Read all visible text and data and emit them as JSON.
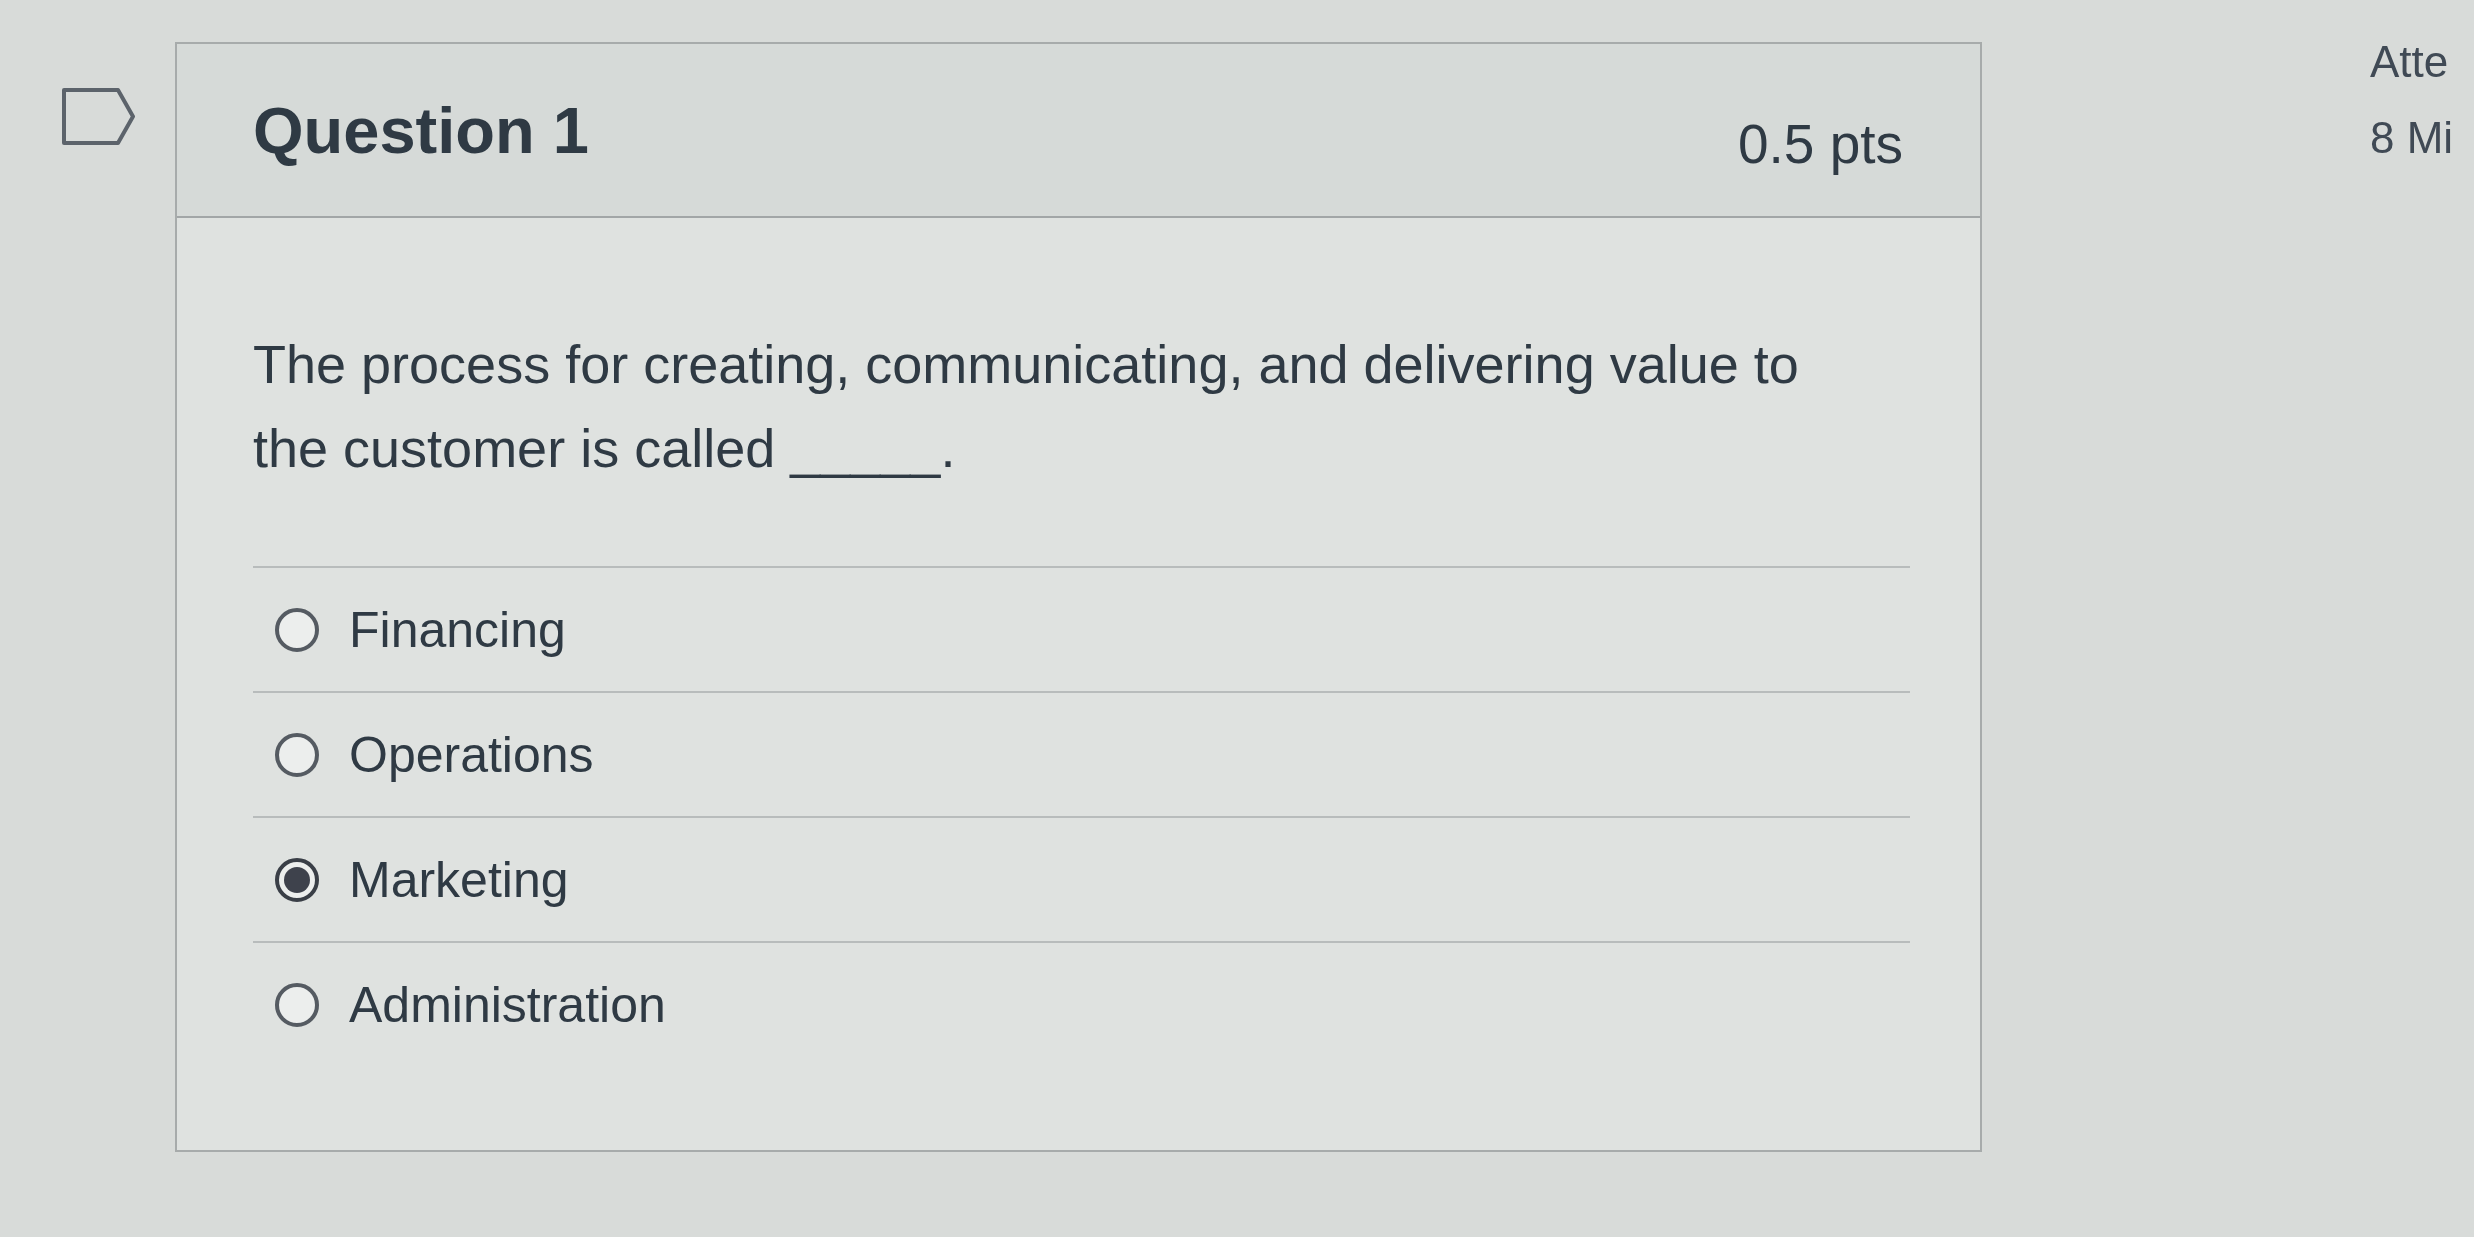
{
  "flag": {
    "flagged": false
  },
  "question": {
    "title": "Question 1",
    "points": "0.5 pts",
    "text": "The process for creating, communicating, and delivering value to the customer is called _____.",
    "answers": [
      {
        "label": "Financing",
        "selected": false
      },
      {
        "label": "Operations",
        "selected": false
      },
      {
        "label": "Marketing",
        "selected": true
      },
      {
        "label": "Administration",
        "selected": false
      }
    ]
  },
  "side_panel": {
    "line_1": "Atte",
    "line_2": "8 Mi"
  }
}
